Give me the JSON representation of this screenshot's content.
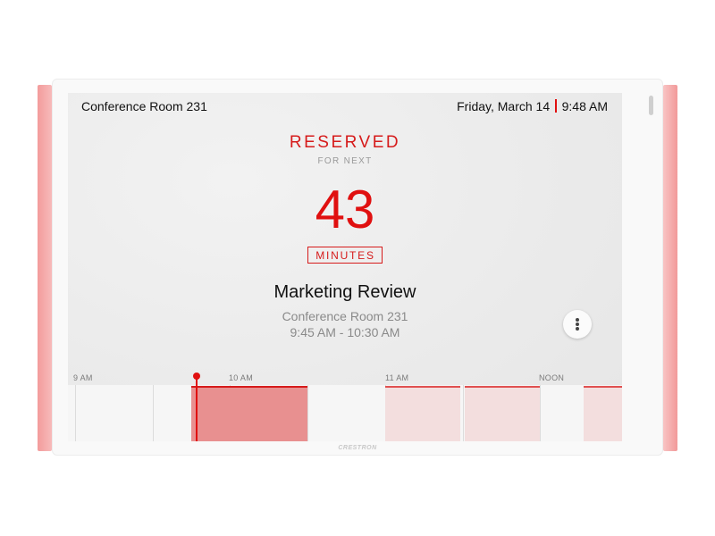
{
  "header": {
    "room_name": "Conference Room 231",
    "date": "Friday, March 14",
    "time": "9:48 AM"
  },
  "status": {
    "label": "RESERVED",
    "sub_label": "FOR NEXT",
    "count": "43",
    "unit": "MINUTES"
  },
  "meeting": {
    "title": "Marketing Review",
    "room": "Conference Room 231",
    "time_range": "9:45 AM - 10:30 AM"
  },
  "timeline": {
    "labels": [
      "9 AM",
      "10 AM",
      "11 AM",
      "NOON"
    ]
  },
  "device": {
    "brand": "CRESTRON"
  },
  "colors": {
    "accent": "#e01010",
    "led": "#f4a3a3",
    "reserved_block": "#e89090",
    "future_block": "#f3dede"
  },
  "icons": {
    "more": "vertical-ellipsis-icon"
  }
}
